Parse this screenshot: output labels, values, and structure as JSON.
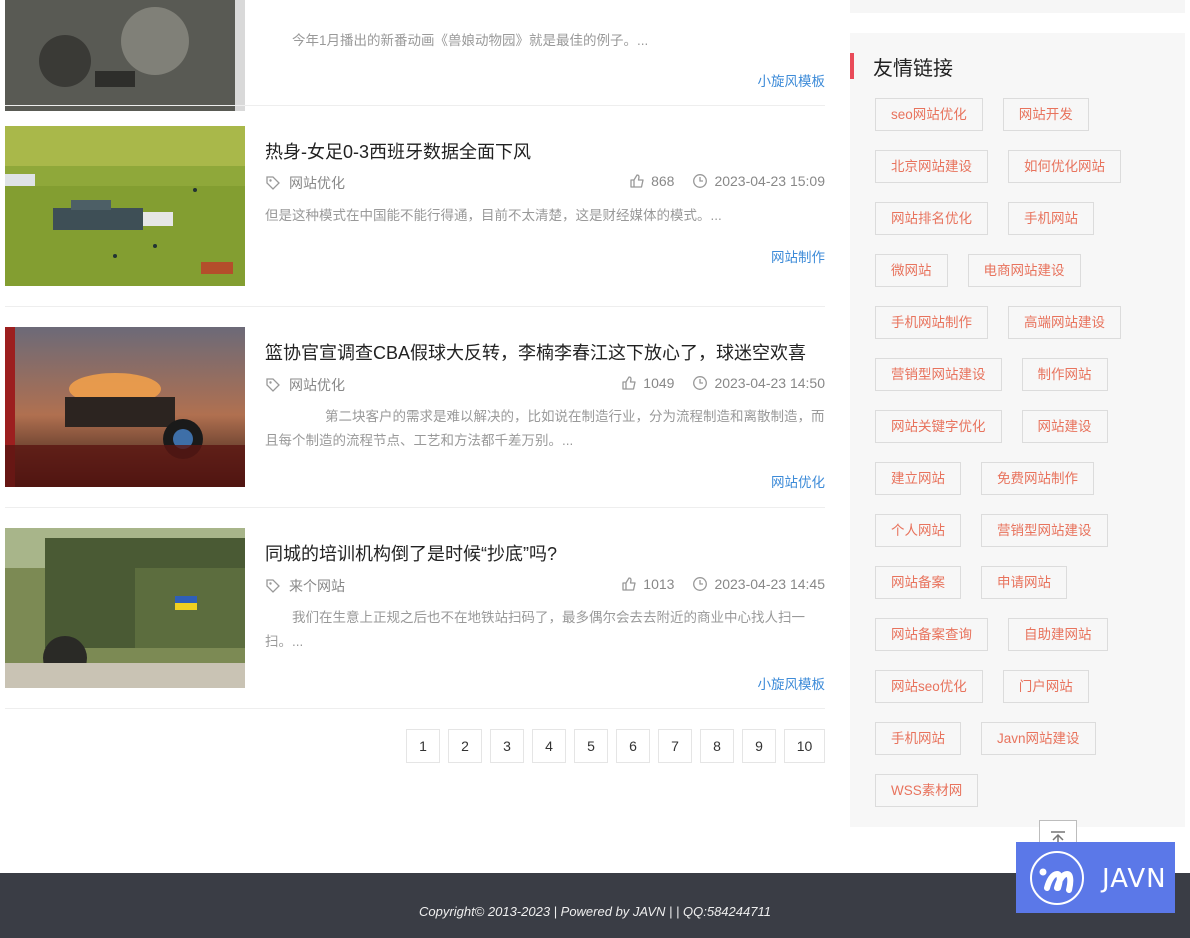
{
  "articles": [
    {
      "title": "",
      "category": "",
      "likes": "",
      "date": "",
      "excerpt": "今年1月播出的新番动画《兽娘动物园》就是最佳的例子。...",
      "tag": "小旋风模板"
    },
    {
      "title": "热身-女足0-3西班牙数据全面下风",
      "category": "网站优化",
      "likes": "868",
      "date": "2023-04-23 15:09",
      "excerpt": "但是这种模式在中国能不能行得通，目前不太清楚，这是财经媒体的模式。...",
      "tag": "网站制作"
    },
    {
      "title": "篮协官宣调查CBA假球大反转，李楠李春江这下放心了，球迷空欢喜",
      "category": "网站优化",
      "likes": "1049",
      "date": "2023-04-23 14:50",
      "excerpt": "第二块客户的需求是难以解决的，比如说在制造行业，分为流程制造和离散制造，而且每个制造的流程节点、工艺和方法都千差万别。...",
      "tag": "网站优化"
    },
    {
      "title": "同城的培训机构倒了是时候“抄底”吗?",
      "category": "来个网站",
      "likes": "1013",
      "date": "2023-04-23 14:45",
      "excerpt": "我们在生意上正规之后也不在地铁站扫码了，最多偶尔会去去附近的商业中心找人扫一扫。...",
      "tag": "小旋风模板"
    }
  ],
  "pagination": [
    "1",
    "2",
    "3",
    "4",
    "5",
    "6",
    "7",
    "8",
    "9",
    "10"
  ],
  "sidebar": {
    "title": "友情链接",
    "links": [
      [
        "seo网站优化",
        "网站开发"
      ],
      [
        "北京网站建设",
        "如何优化网站"
      ],
      [
        "网站排名优化",
        "手机网站"
      ],
      [
        "微网站",
        "电商网站建设"
      ],
      [
        "手机网站制作",
        "高端网站建设"
      ],
      [
        "营销型网站建设",
        "制作网站"
      ],
      [
        "网站关键字优化",
        "网站建设"
      ],
      [
        "建立网站",
        "免费网站制作"
      ],
      [
        "个人网站",
        "营销型网站建设"
      ],
      [
        "网站备案",
        "申请网站"
      ],
      [
        "网站备案查询",
        "自助建网站"
      ],
      [
        "网站seo优化",
        "门户网站"
      ],
      [
        "手机网站",
        "Javn网站建设"
      ],
      [
        "WSS素材网"
      ]
    ]
  },
  "footer": {
    "text": "Copyright© 2013-2023  |  Powered by JAVN  |    |  QQ:584244711"
  },
  "brand": {
    "name": "JAVN"
  },
  "colors": {
    "accent": "#e94b59",
    "link_blue": "#3d8bd8",
    "chip_text": "#e8735d",
    "footer_bg": "#3a3d45",
    "brand_bg": "#5b78e8"
  },
  "icons": {
    "tag": "tag-icon",
    "like": "thumbs-up-icon",
    "clock": "clock-icon",
    "back_to_top": "arrow-up-to-top-icon"
  }
}
